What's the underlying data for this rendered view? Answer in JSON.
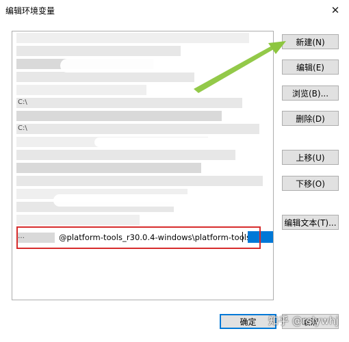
{
  "window": {
    "title": "编辑环境变量",
    "close_symbol": "✕"
  },
  "list": {
    "selected_value": "@platform-tools_r30.0.4-windows\\platform-tools",
    "obscured_prefix": "…"
  },
  "buttons": {
    "new": "新建(N)",
    "edit": "编辑(E)",
    "browse": "浏览(B)...",
    "delete": "删除(D)",
    "move_up": "上移(U)",
    "move_down": "下移(O)",
    "edit_text": "编辑文本(T)...",
    "ok": "确定",
    "cancel": "取消"
  },
  "watermark": "知乎 @rslywhj",
  "colors": {
    "selection": "#0078d7",
    "highlight_box": "#d72b2b",
    "arrow": "#8dc63f"
  }
}
